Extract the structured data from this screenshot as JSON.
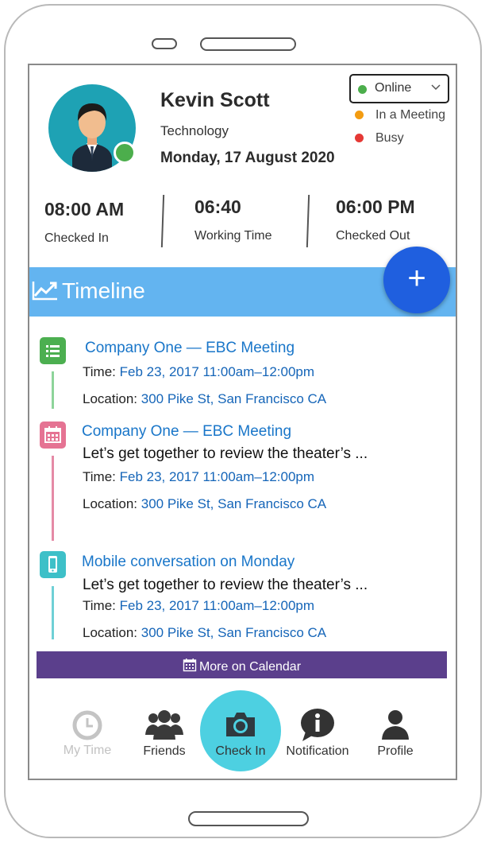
{
  "profile": {
    "name": "Kevin Scott",
    "department": "Technology",
    "date": "Monday, 17 August 2020"
  },
  "status": {
    "selected": "Online",
    "options": [
      {
        "label": "In a Meeting",
        "color": "#f39c12"
      },
      {
        "label": "Busy",
        "color": "#e53935"
      }
    ],
    "online_color": "#4cae4c"
  },
  "times": {
    "checked_in": {
      "value": "08:00 AM",
      "label": "Checked In"
    },
    "working": {
      "value": "06:40",
      "label": "Working Time"
    },
    "checked_out": {
      "value": "06:00 PM",
      "label": "Checked Out"
    }
  },
  "timeline": {
    "title": "Timeline",
    "add_label": "+",
    "events": [
      {
        "icon": "list-icon",
        "color": "#4caf50",
        "title": "Company One — EBC Meeting",
        "time_label": "Time:",
        "time": "Feb 23, 2017 11:00am–12:00pm",
        "location_label": "Location:",
        "location": "300 Pike St, San Francisco CA"
      },
      {
        "icon": "calendar-icon",
        "color": "#e57393",
        "title": "Company One — EBC Meeting",
        "description": "Let’s get together to review the theater’s ...",
        "time_label": "Time:",
        "time": "Feb 23, 2017 11:00am–12:00pm",
        "location_label": "Location:",
        "location": "300 Pike St, San Francisco CA"
      },
      {
        "icon": "mobile-icon",
        "color": "#3ec0c8",
        "title": "Mobile conversation on Monday",
        "description": "Let’s get together to review the theater’s ...",
        "time_label": "Time:",
        "time": "Feb 23, 2017 11:00am–12:00pm",
        "location_label": "Location:",
        "location": "300 Pike St, San Francisco CA"
      }
    ],
    "more_label": "More on Calendar"
  },
  "nav": {
    "items": [
      {
        "label": "My Time",
        "icon": "clock-icon",
        "state": "disabled"
      },
      {
        "label": "Friends",
        "icon": "group-icon"
      },
      {
        "label": "Check In",
        "icon": "camera-icon",
        "state": "active"
      },
      {
        "label": "Notification",
        "icon": "info-icon"
      },
      {
        "label": "Profile",
        "icon": "person-icon"
      }
    ]
  },
  "colors": {
    "timeline_bar": "#63b4f0",
    "fab": "#1f5fdf",
    "more_button": "#5b3f8c",
    "checkin_active": "#4dd0e1",
    "link_blue": "#1565b8"
  }
}
